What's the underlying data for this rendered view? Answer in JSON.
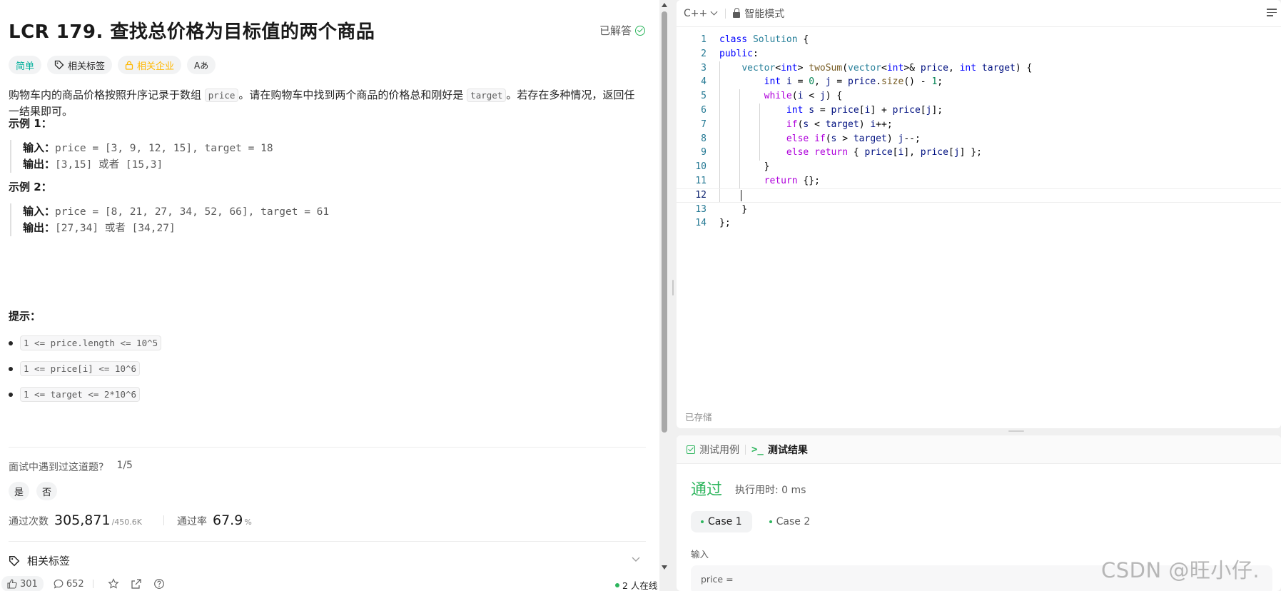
{
  "problem": {
    "title": "LCR 179. 查找总价格为目标值的两个商品",
    "solved_label": "已解答",
    "tags": {
      "difficulty": "简单",
      "related_tags": "相关标签",
      "related_companies": "相关企业",
      "translate": "Aあ"
    },
    "description": {
      "p1": "购物车内的商品价格按照升序记录于数组 ",
      "code1": "price",
      "p2": "。请在购物车中找到两个商品的价格总和刚好是 ",
      "code2": "target",
      "p3": "。若存在多种情况，返回任一结果即可。"
    },
    "examples": [
      {
        "title": "示例 1：",
        "input_label": "输入：",
        "input": "price = [3, 9, 12, 15], target = 18",
        "output_label": "输出：",
        "output": "[3,15] 或者 [15,3]"
      },
      {
        "title": "示例 2：",
        "input_label": "输入：",
        "input": "price = [8, 21, 27, 34, 52, 66], target = 61",
        "output_label": "输出：",
        "output": "[27,34] 或者 [34,27]"
      }
    ],
    "hints_title": "提示：",
    "hints": [
      "1 <= price.length <= 10^5",
      "1 <= price[i] <= 10^6",
      "1 <= target <= 2*10^6"
    ],
    "interview": {
      "question": "面试中遇到过这道题?",
      "page": "1/5",
      "yes": "是",
      "no": "否"
    },
    "stats": {
      "accepted_label": "通过次数",
      "accepted": "305,871",
      "submissions": "/450.6K",
      "rate_label": "通过率",
      "rate": "67.9",
      "rate_unit": "%"
    },
    "related_section": "相关标签",
    "bottom": {
      "likes": "301",
      "comments": "652",
      "online": "2 人在线"
    }
  },
  "editor": {
    "language": "C++",
    "mode": "智能模式",
    "saved": "已存储",
    "line_numbers": [
      "1",
      "2",
      "3",
      "4",
      "5",
      "6",
      "7",
      "8",
      "9",
      "10",
      "11",
      "12",
      "13",
      "14"
    ],
    "current_line": "12"
  },
  "results": {
    "tab_testcase": "测试用例",
    "tab_result": "测试结果",
    "status": "通过",
    "runtime": "执行用时: 0 ms",
    "cases": [
      "Case 1",
      "Case 2"
    ],
    "input_label": "输入",
    "input_var": "price ="
  },
  "watermark": "CSDN @旺小仔.",
  "colors": {
    "easy": "#00af9b",
    "company": "#ffb800",
    "pass_green": "#2db55d"
  }
}
